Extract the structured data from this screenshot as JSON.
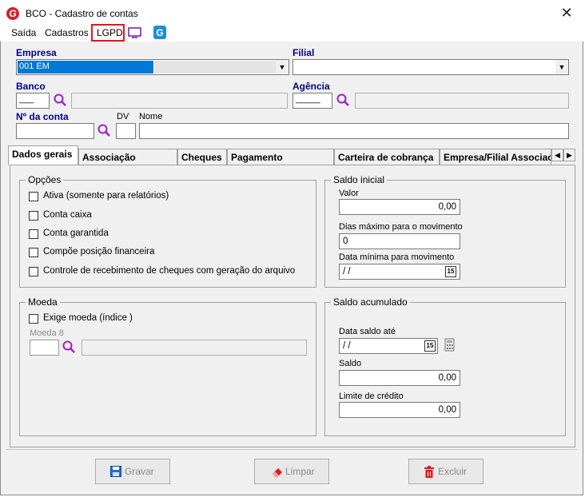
{
  "window": {
    "title": "BCO - Cadastro de contas",
    "close": "✕"
  },
  "menu": {
    "items": [
      "Saída",
      "Cadastros",
      "LGPD"
    ]
  },
  "fields": {
    "empresa": {
      "label": "Empresa",
      "value": "001 EM"
    },
    "filial": {
      "label": "Filial",
      "value": ""
    },
    "banco": {
      "label": "Banco",
      "value": "___"
    },
    "agencia": {
      "label": "Agência",
      "value": "_____"
    },
    "nconta": {
      "label": "Nº da conta",
      "value": ""
    },
    "dv": {
      "label": "DV"
    },
    "nome": {
      "label": "Nome"
    }
  },
  "tabs": [
    "Dados gerais",
    "Associação contábil",
    "Cheques",
    "Pagamento eletrônico",
    "Carteira de cobrança",
    "Empresa/Filial Associac"
  ],
  "opcoes": {
    "title": "Opções",
    "items": [
      "Ativa (somente para relatórios)",
      "Conta caixa",
      "Conta garantida",
      "Compõe posição financeira",
      "Controle de recebimento de cheques com geração do arquivo"
    ]
  },
  "saldo_inicial": {
    "title": "Saldo inicial",
    "valor_label": "Valor",
    "valor": "0,00",
    "dias_label": "Dias máximo para o movimento",
    "dias": "0",
    "data_label": "Data mínima para movimento",
    "data": " /  /"
  },
  "moeda": {
    "title": "Moeda",
    "exige_label": "Exige moeda (índice )",
    "moeda_label": "Moeda 8"
  },
  "saldo_acumulado": {
    "title": "Saldo acumulado",
    "data_label": "Data saldo até",
    "data": " /  /",
    "saldo_label": "Saldo",
    "saldo": "0,00",
    "limite_label": "Limite de crédito",
    "limite": "0,00"
  },
  "calendar_glyph": "15",
  "buttons": {
    "gravar": "Gravar",
    "limpar": "Limpar",
    "excluir": "Excluir"
  },
  "colors": {
    "highlight": "#e4141c",
    "label_blue": "#000080",
    "selection": "#0078d7"
  }
}
